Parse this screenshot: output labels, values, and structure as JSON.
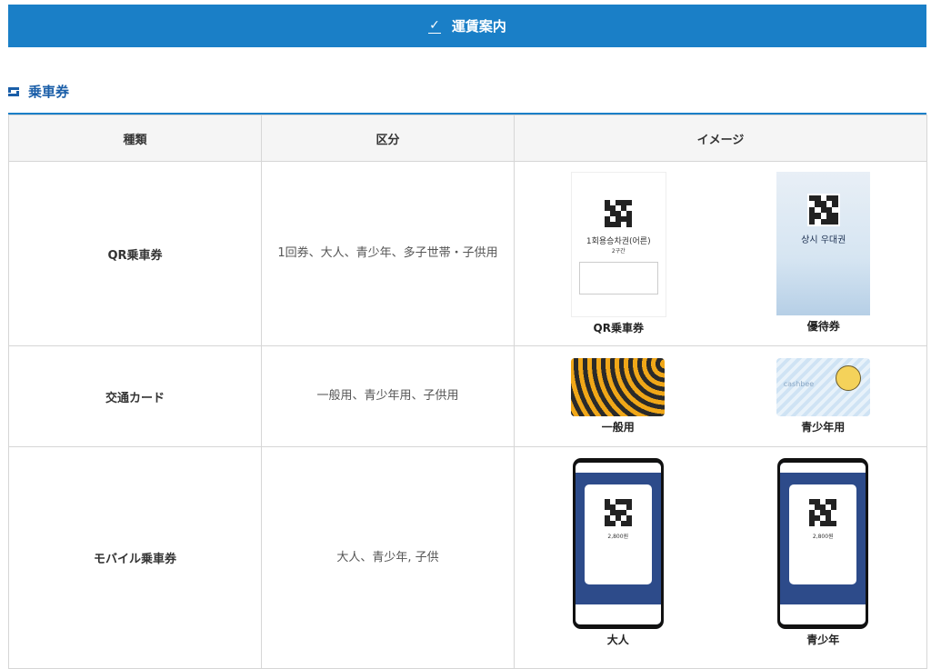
{
  "banner": {
    "check_icon": "checkmark-icon",
    "title": "運賃案内",
    "color": "#1a7fc7"
  },
  "section": {
    "icon": "section-marker-icon",
    "title": "乗車券"
  },
  "table": {
    "headers": [
      "種類",
      "区分",
      "イメージ"
    ],
    "rows": [
      {
        "kind": "QR乗車券",
        "division": "1回券、大人、青少年、多子世帯・子供用",
        "images": [
          {
            "caption": "QR乗車券",
            "ticket_text": "1회용승차권(어른)",
            "ticket_sub": "2구간"
          },
          {
            "caption": "優待券",
            "ticket_text": "상시 우대권"
          }
        ]
      },
      {
        "kind": "交通カード",
        "division": "一般用、青少年用、子供用",
        "images": [
          {
            "caption": "一般用"
          },
          {
            "caption": "青少年用",
            "card_text": "cashbee"
          }
        ]
      },
      {
        "kind": "モバイル乗車券",
        "division": "大人、青少年, 子供",
        "images": [
          {
            "caption": "大人",
            "fare": "2,800원"
          },
          {
            "caption": "青少年",
            "fare": "2,800원"
          }
        ]
      }
    ]
  }
}
